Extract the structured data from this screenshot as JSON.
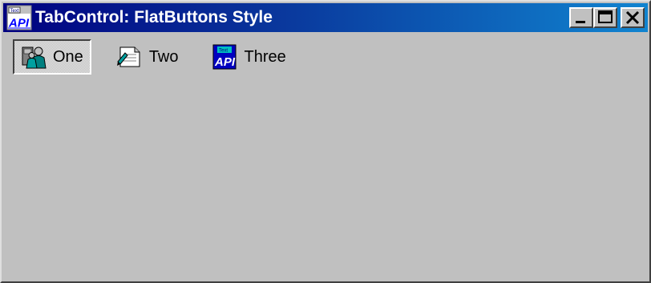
{
  "window": {
    "title": "TabControl: FlatButtons Style",
    "app_icon": "api-viewer-icon"
  },
  "title_buttons": [
    {
      "name": "minimize-icon"
    },
    {
      "name": "maximize-icon"
    },
    {
      "name": "close-icon"
    }
  ],
  "tabs": [
    {
      "label": "One",
      "icon": "people-icon",
      "selected": true
    },
    {
      "label": "Two",
      "icon": "document-icon",
      "selected": false
    },
    {
      "label": "Three",
      "icon": "api-viewer-icon",
      "selected": false
    }
  ],
  "colors": {
    "titlebar_start": "#000080",
    "titlebar_end": "#1084d0",
    "face": "#c0c0c0"
  }
}
